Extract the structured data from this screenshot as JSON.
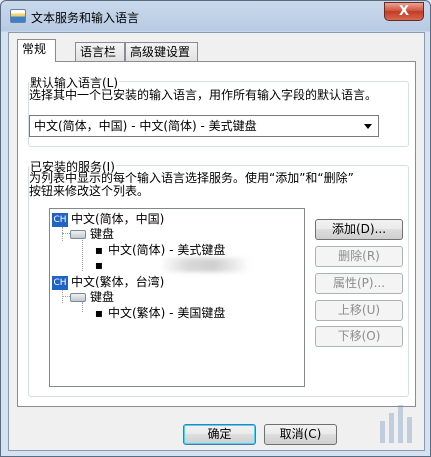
{
  "window": {
    "title": "文本服务和输入语言",
    "close_glyph": "X"
  },
  "tabs": [
    {
      "label": "常规",
      "active": true
    },
    {
      "label": "语言栏",
      "active": false
    },
    {
      "label": "高级键设置",
      "active": false
    }
  ],
  "default_language": {
    "title": "默认输入语言(L)",
    "description": "选择其中一个已安装的输入语言，用作所有输入字段的默认语言。",
    "selected": "中文(简体，中国) - 中文(简体) - 美式键盘"
  },
  "installed_services": {
    "title": "已安装的服务(I)",
    "description_line1": "为列表中显示的每个输入语言选择服务。使用“添加”和“删除”",
    "description_line2": "按钮来修改这个列表。",
    "tree": {
      "lang1": {
        "badge": "CH",
        "label": "中文(简体，中国)"
      },
      "lang1_keyboard": "键盘",
      "lang1_item": "中文(简体) - 美式键盘",
      "lang2": {
        "badge": "CH",
        "label": "中文(繁体，台湾)"
      },
      "lang2_keyboard": "键盘",
      "lang2_item": "中文(繁体) - 美国键盘",
      "bullet": "▪"
    },
    "buttons": {
      "add": "添加(D)...",
      "remove": "删除(R)",
      "properties": "属性(P)...",
      "move_up": "上移(U)",
      "move_down": "下移(O)"
    }
  },
  "footer": {
    "ok": "确定",
    "cancel": "取消(C)"
  },
  "colors": {
    "titlebar": "#c9d9ec",
    "close_button": "#c23a24",
    "lang_badge": "#1f63c6"
  }
}
